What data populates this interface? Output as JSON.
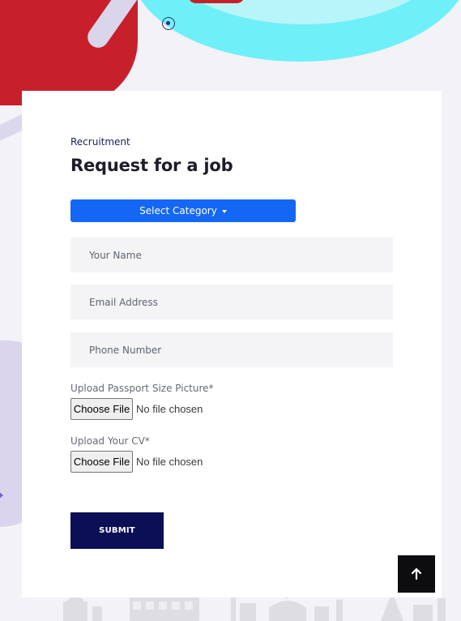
{
  "form": {
    "eyebrow": "Recruitment",
    "title": "Request for a job",
    "category_button": "Select Category",
    "name_placeholder": "Your Name",
    "email_placeholder": "Email Address",
    "phone_placeholder": "Phone Number",
    "picture_label": "Upload Passport Size Picture*",
    "cv_label": "Upload Your CV*",
    "choose_file_label": "Choose File",
    "no_file_text": "No file chosen",
    "submit_label": "SUBMIT"
  },
  "icons": {
    "category_caret": "caret-down-icon",
    "scroll_top": "arrow-up-icon"
  },
  "colors": {
    "primary_button": "#1467f5",
    "submit_button": "#0b0f55",
    "input_background": "#f4f4f6",
    "scroll_top_button": "#0d0d10",
    "accent_red": "#c8202b",
    "accent_cyan": "#6ff0f8"
  }
}
